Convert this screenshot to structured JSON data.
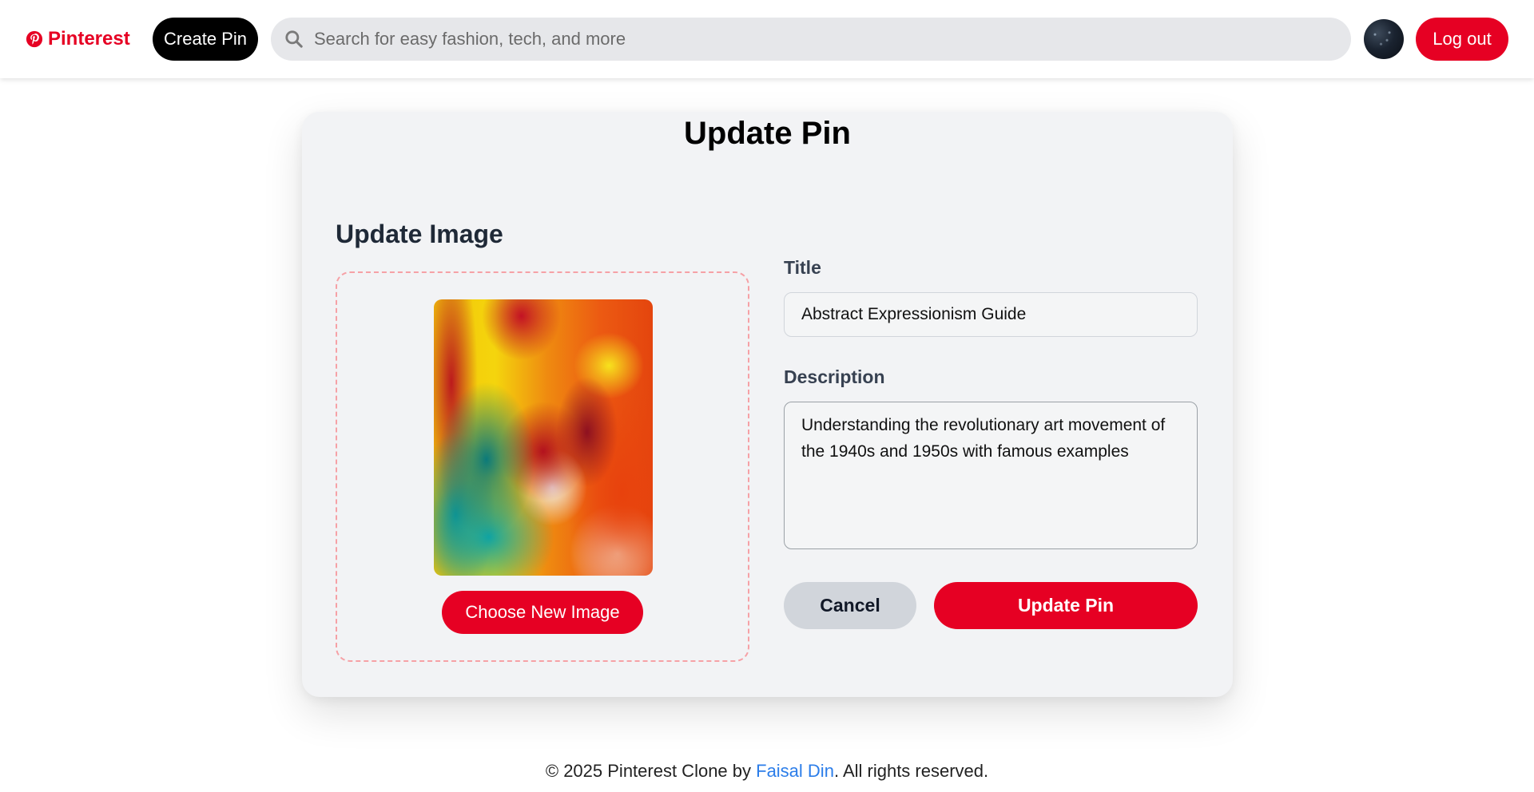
{
  "header": {
    "logo_text": "Pinterest",
    "logo_icon": "pinterest-logo-icon",
    "create_pin_label": "Create Pin",
    "search_placeholder": "Search for easy fashion, tech, and more",
    "search_icon": "search-icon",
    "logout_label": "Log out"
  },
  "card": {
    "title": "Update Pin",
    "image_section": {
      "heading": "Update Image",
      "choose_button_label": "Choose New Image"
    },
    "form": {
      "title_label": "Title",
      "title_value": "Abstract Expressionism Guide",
      "description_label": "Description",
      "description_value": "Understanding the revolutionary art movement of the 1940s and 1950s with famous examples",
      "cancel_label": "Cancel",
      "submit_label": "Update Pin"
    }
  },
  "footer": {
    "prefix": "© 2025 Pinterest Clone by ",
    "author": "Faisal Din",
    "suffix": ". All rights reserved."
  },
  "colors": {
    "brand_red": "#e60023",
    "link_blue": "#2b7de9",
    "card_background": "#f2f3f5",
    "dropzone_border": "#f6a1a6"
  }
}
